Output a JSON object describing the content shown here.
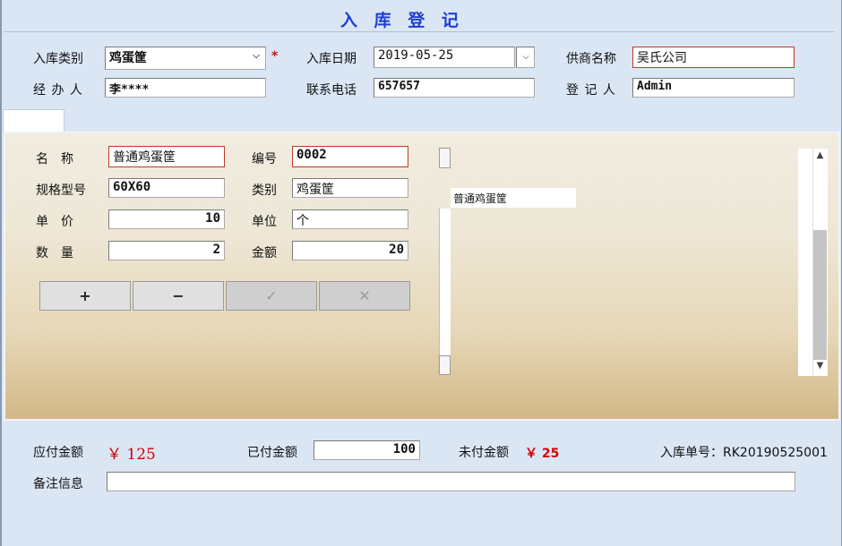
{
  "header": {
    "title": "入 库 登 记"
  },
  "form": {
    "category_label": "入库类别",
    "category_value": "鸡蛋筐",
    "required_mark": "*",
    "date_label": "入库日期",
    "date_value": "2019-05-25",
    "supplier_label": "供商名称",
    "supplier_value": "吴氏公司",
    "handler_label": "经 办 人",
    "handler_value": "李****",
    "phone_label": "联系电话",
    "phone_value": "657657",
    "registrar_label": "登 记 人",
    "registrar_value": "Admin"
  },
  "item": {
    "name_label": "名　称",
    "name_value": "普通鸡蛋筐",
    "code_label": "编号",
    "code_value": "0002",
    "spec_label": "规格型号",
    "spec_value": "60X60",
    "type_label": "类别",
    "type_value": "鸡蛋筐",
    "price_label": "单　价",
    "price_value": "10",
    "unit_label": "单位",
    "unit_value": "个",
    "qty_label": "数　量",
    "qty_value": "2",
    "amount_label": "金额",
    "amount_value": "20"
  },
  "buttons": {
    "add": "+",
    "remove": "−",
    "confirm": "✓",
    "cancel": "✕"
  },
  "list": {
    "items": [
      "普通鸡蛋筐"
    ]
  },
  "footer": {
    "payable_label": "应付金额",
    "payable_value": "￥ 125",
    "paid_label": "已付金额",
    "paid_value": "100",
    "unpaid_label": "未付金额",
    "unpaid_value": "￥ 25",
    "order_text": "入库单号：RK20190525001",
    "remark_label": "备注信息",
    "remark_value": ""
  },
  "colors": {
    "title": "#1d3fd6",
    "money": "#d40000",
    "required": "#d01818"
  }
}
